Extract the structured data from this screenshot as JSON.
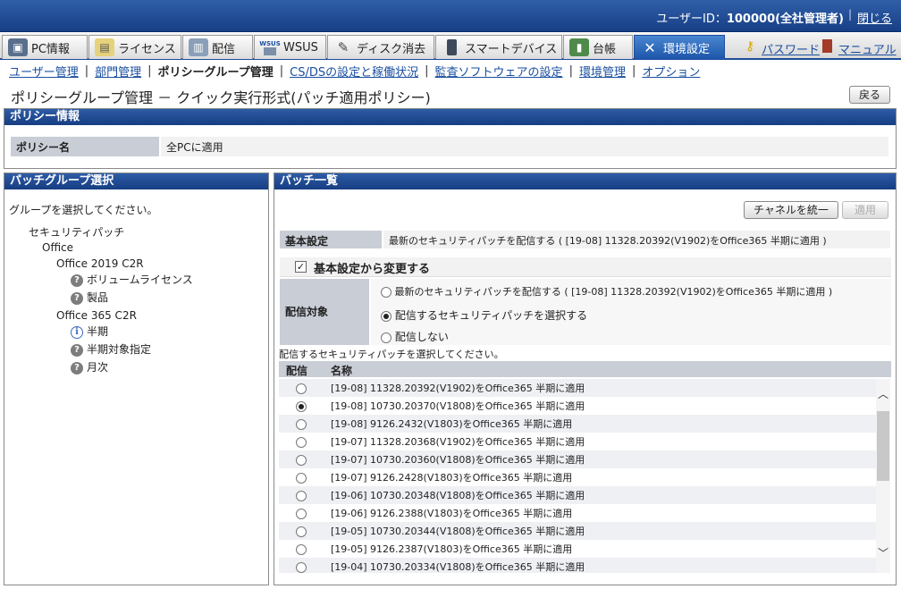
{
  "header": {
    "user_label": "ユーザーID：",
    "user_id": "100000(全社管理者)",
    "separator": "|",
    "logout": "閉じる"
  },
  "tabs": [
    {
      "label": "PC情報",
      "icon": "pc-icon"
    },
    {
      "label": "ライセンス",
      "icon": "license-icon"
    },
    {
      "label": "配信",
      "icon": "distribution-icon"
    },
    {
      "label": "WSUS",
      "icon": "wsus-icon"
    },
    {
      "label": "ディスク消去",
      "icon": "disk-erase-icon"
    },
    {
      "label": "スマートデバイス",
      "icon": "smart-device-icon"
    },
    {
      "label": "台帳",
      "icon": "ledger-icon"
    },
    {
      "label": "環境設定",
      "icon": "settings-icon"
    }
  ],
  "wsus_badge": "WSUS",
  "right_links": {
    "password": "パスワード",
    "manual": "マニュアル"
  },
  "subnav": {
    "items": [
      "ユーザー管理",
      "部門管理",
      "ポリシーグループ管理",
      "CS/DSの設定と稼働状況",
      "監査ソフトウェアの設定",
      "環境管理",
      "オプション"
    ],
    "current_index": 2,
    "separator": "|"
  },
  "page_title": "ポリシーグループ管理 － クイック実行形式(パッチ適用ポリシー)",
  "back_button": "戻る",
  "policy_section": {
    "header": "ポリシー情報",
    "name_label": "ポリシー名",
    "name_value": "全PCに適用"
  },
  "group_section": {
    "header": "パッチグループ選択",
    "instruction": "グループを選択してください。",
    "tree": {
      "root": "セキュリティパッチ",
      "office": "Office",
      "c2r2019": "Office 2019 C2R",
      "volume": "ボリュームライセンス",
      "product": "製品",
      "c2r365": "Office 365 C2R",
      "half": "半期",
      "half_target": "半期対象指定",
      "monthly": "月次"
    }
  },
  "patch_section": {
    "header": "パッチ一覧",
    "unify_button": "チャネルを統一",
    "apply_button": "適用",
    "basic_label": "基本設定",
    "basic_value": "最新のセキュリティパッチを配信する ( [19-08] 11328.20392(V1902)をOffice365 半期に適用 )",
    "change_checkbox": "基本設定から変更する",
    "target_label": "配信対象",
    "options": [
      "最新のセキュリティパッチを配信する ( [19-08] 11328.20392(V1902)をOffice365 半期に適用 )",
      "配信するセキュリティパッチを選択する",
      "配信しない"
    ],
    "selected_option": 1,
    "list_instruction": "配信するセキュリティパッチを選択してください。",
    "col_deliver": "配信",
    "col_name": "名称",
    "patches": [
      "[19-08] 11328.20392(V1902)をOffice365 半期に適用",
      "[19-08] 10730.20370(V1808)をOffice365 半期に適用",
      "[19-08] 9126.2432(V1803)をOffice365 半期に適用",
      "[19-07] 11328.20368(V1902)をOffice365 半期に適用",
      "[19-07] 10730.20360(V1808)をOffice365 半期に適用",
      "[19-07] 9126.2428(V1803)をOffice365 半期に適用",
      "[19-06] 10730.20348(V1808)をOffice365 半期に適用",
      "[19-06] 9126.2388(V1803)をOffice365 半期に適用",
      "[19-05] 10730.20344(V1808)をOffice365 半期に適用",
      "[19-05] 9126.2387(V1803)をOffice365 半期に適用",
      "[19-04] 10730.20334(V1808)をOffice365 半期に適用"
    ],
    "selected_patch": 1
  },
  "colors": {
    "header_blue": "#1f4d9a",
    "link": "#1a4fa0",
    "active_tab": "#2a63b4"
  }
}
